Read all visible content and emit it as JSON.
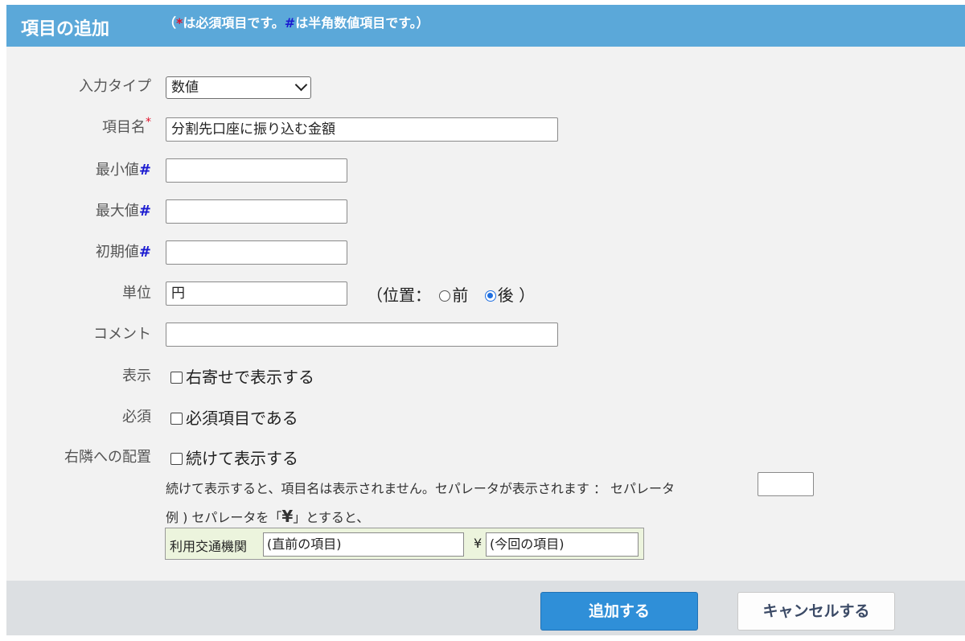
{
  "header": {
    "title": "項目の追加",
    "note_open": "（",
    "note_star": "*",
    "note_required": "は必須項目です。",
    "note_hash": "#",
    "note_numeric": "は半角数値項目です。）"
  },
  "form": {
    "input_type": {
      "label": "入力タイプ",
      "selected": "数値"
    },
    "item_name": {
      "label": "項目名",
      "marker": "*",
      "value": "分割先口座に振り込む金額"
    },
    "min_value": {
      "label": "最小値",
      "marker": "#",
      "value": ""
    },
    "max_value": {
      "label": "最大値",
      "marker": "#",
      "value": ""
    },
    "initial_value": {
      "label": "初期値",
      "marker": "#",
      "value": ""
    },
    "unit": {
      "label": "単位",
      "value": "円",
      "position_prefix": "（位置：",
      "option_before": "前",
      "option_after": "後",
      "position_suffix": "）",
      "selected": "後"
    },
    "comment": {
      "label": "コメント",
      "value": ""
    },
    "display": {
      "label": "表示",
      "checkbox_label": "右寄せで表示する",
      "checked": false
    },
    "required": {
      "label": "必須",
      "checkbox_label": "必須項目である",
      "checked": false
    },
    "place_right": {
      "label": "右隣への配置",
      "checkbox_label": "続けて表示する",
      "checked": false,
      "help_text": "続けて表示すると、項目名は表示されません。セパレータが表示されます ： セパレータ",
      "separator_value": "",
      "example_prefix": "例 ) セパレータを「",
      "example_yen": "¥",
      "example_suffix": "」とすると、",
      "example": {
        "label": "利用交通機関",
        "prev_field": "(直前の項目)",
        "separator": "¥",
        "current_field": "(今回の項目)"
      }
    }
  },
  "footer": {
    "add_button": "追加する",
    "cancel_button": "キャンセルする"
  },
  "colors": {
    "header_bg": "#5ba8d9",
    "required_marker": "#e0142c",
    "numeric_marker": "#1a1ad0",
    "primary_button": "#2f8fd8",
    "example_bg": "#ecf4dd"
  }
}
